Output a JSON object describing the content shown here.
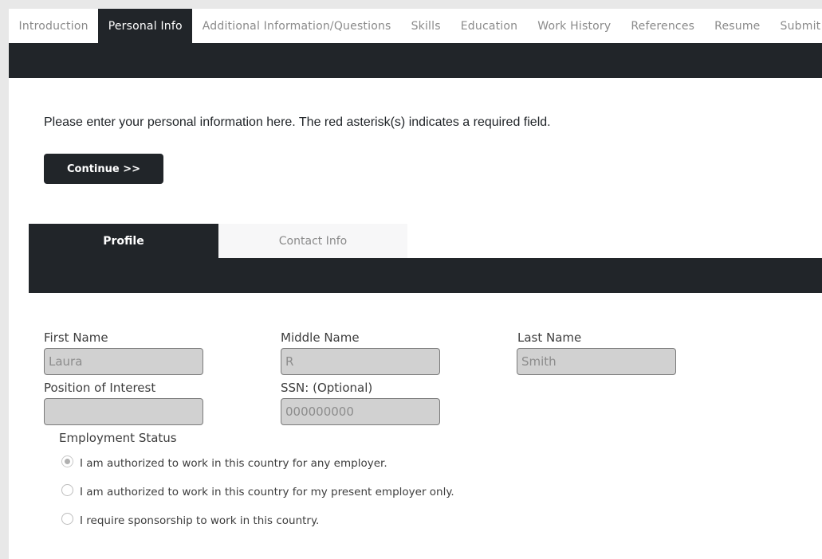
{
  "nav": {
    "tabs": [
      {
        "label": "Introduction",
        "active": false
      },
      {
        "label": "Personal Info",
        "active": true
      },
      {
        "label": "Additional Information/Questions",
        "active": false
      },
      {
        "label": "Skills",
        "active": false
      },
      {
        "label": "Education",
        "active": false
      },
      {
        "label": "Work History",
        "active": false
      },
      {
        "label": "References",
        "active": false
      },
      {
        "label": "Resume",
        "active": false
      },
      {
        "label": "Submit",
        "active": false
      }
    ]
  },
  "intro": {
    "text": "Please enter your personal information here.  The red asterisk(s) indicates a required field.",
    "continue_label": "Continue >>"
  },
  "subtabs": {
    "profile": "Profile",
    "contact": "Contact Info"
  },
  "form": {
    "first_name": {
      "label": "First Name",
      "value": "Laura"
    },
    "middle_name": {
      "label": "Middle Name",
      "value": "R"
    },
    "last_name": {
      "label": "Last Name",
      "value": "Smith"
    },
    "position": {
      "label": "Position of Interest",
      "value": ""
    },
    "ssn": {
      "label": "SSN: (Optional)",
      "value": "000000000"
    }
  },
  "employment": {
    "label": "Employment Status",
    "options": [
      {
        "text": "I am authorized to work in this country for any employer.",
        "selected": true
      },
      {
        "text": "I am authorized to work in this country for my present employer only.",
        "selected": false
      },
      {
        "text": "I require sponsorship to work in this country.",
        "selected": false
      }
    ]
  },
  "colors": {
    "dark": "#212529",
    "input_bg": "#d1d1d1",
    "muted_text": "#8a8a8a"
  }
}
